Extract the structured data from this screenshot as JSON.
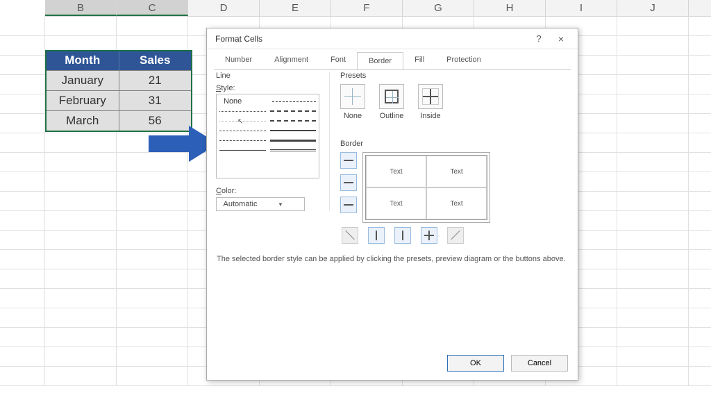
{
  "columns": [
    "B",
    "C",
    "D",
    "E",
    "F",
    "G",
    "H",
    "I",
    "J"
  ],
  "selected_cols": [
    "B",
    "C"
  ],
  "table": {
    "headers": [
      "Month",
      "Sales"
    ],
    "rows": [
      {
        "month": "January",
        "sales": "21"
      },
      {
        "month": "February",
        "sales": "31"
      },
      {
        "month": "March",
        "sales": "56"
      }
    ]
  },
  "dialog": {
    "title": "Format Cells",
    "help": "?",
    "close": "×",
    "tabs": [
      "Number",
      "Alignment",
      "Font",
      "Border",
      "Fill",
      "Protection"
    ],
    "active_tab": "Border",
    "line": {
      "group_label": "Line",
      "style_label": "Style:",
      "none_text": "None",
      "color_label": "Color:",
      "color_value": "Automatic"
    },
    "presets": {
      "group_label": "Presets",
      "items": [
        "None",
        "Outline",
        "Inside"
      ]
    },
    "border": {
      "group_label": "Border",
      "preview_text": "Text"
    },
    "hint": "The selected border style can be applied by clicking the presets, preview diagram or the buttons above.",
    "buttons": {
      "ok": "OK",
      "cancel": "Cancel"
    }
  }
}
